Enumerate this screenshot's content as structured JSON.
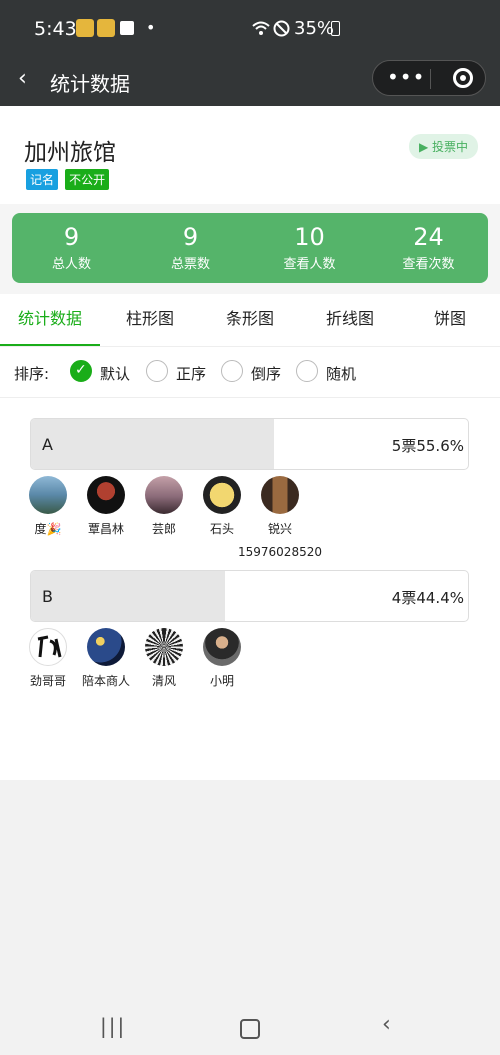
{
  "status_bar": {
    "time": "5:43",
    "dot": "•",
    "battery": "35%"
  },
  "nav": {
    "back": "‹",
    "title": "统计数据",
    "more": "•••"
  },
  "header": {
    "title": "加州旅馆",
    "tags": [
      "记名",
      "不公开"
    ],
    "status": "▶ 投票中"
  },
  "stats": [
    {
      "value": "9",
      "label": "总人数"
    },
    {
      "value": "9",
      "label": "总票数"
    },
    {
      "value": "10",
      "label": "查看人数"
    },
    {
      "value": "24",
      "label": "查看次数"
    }
  ],
  "tabs": [
    "统计数据",
    "柱形图",
    "条形图",
    "折线图",
    "饼图"
  ],
  "sort": {
    "label": "排序:",
    "options": [
      "默认",
      "正序",
      "倒序",
      "随机"
    ],
    "selected": "默认"
  },
  "options": [
    {
      "name": "A",
      "result": "5票55.6%",
      "percent": 55.6,
      "voters": [
        "度🎉",
        "覃昌林",
        "芸郎",
        "石头",
        "锐兴"
      ],
      "extra": "15976028520"
    },
    {
      "name": "B",
      "result": "4票44.4%",
      "percent": 44.4,
      "voters": [
        "劲哥哥",
        "陪本商人",
        "清风",
        "小明"
      ]
    }
  ],
  "colors": {
    "accent": "#1aad19",
    "stats_bg": "#55b46a",
    "tag_blue": "#18a0e0"
  },
  "system_nav": {
    "recent": "|||",
    "back": "‹"
  }
}
